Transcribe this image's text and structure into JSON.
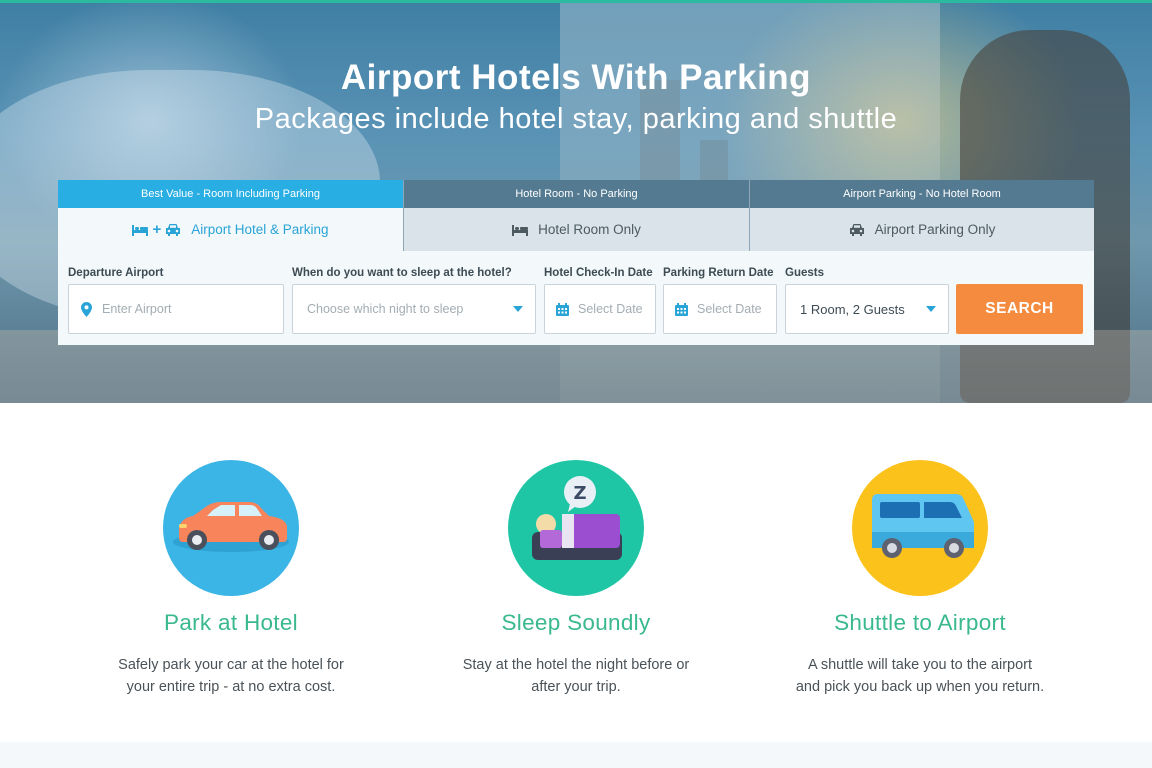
{
  "hero": {
    "title": "Airport Hotels With Parking",
    "subtitle": "Packages include hotel stay, parking and shuttle"
  },
  "tabs": [
    {
      "header": "Best Value - Room Including Parking",
      "label": "Airport Hotel & Parking",
      "icons": [
        "bed-icon",
        "plus-icon",
        "car-icon"
      ],
      "active": true
    },
    {
      "header": "Hotel Room - No Parking",
      "label": "Hotel Room Only",
      "icons": [
        "bed-icon"
      ],
      "active": false
    },
    {
      "header": "Airport Parking - No Hotel Room",
      "label": "Airport Parking Only",
      "icons": [
        "car-icon"
      ],
      "active": false
    }
  ],
  "form": {
    "departure": {
      "label": "Departure Airport",
      "placeholder": "Enter Airport",
      "icon": "map-pin-icon"
    },
    "sleep_night": {
      "label": "When do you want to sleep at the hotel?",
      "placeholder": "Choose which night to sleep"
    },
    "checkin": {
      "label": "Hotel Check-In Date",
      "placeholder": "Select Date",
      "icon": "calendar-icon"
    },
    "parking_return": {
      "label": "Parking Return Date",
      "placeholder": "Select Date",
      "icon": "calendar-icon"
    },
    "guests": {
      "label": "Guests",
      "value": "1 Room, 2 Guests"
    },
    "search_label": "SEARCH"
  },
  "features": [
    {
      "title": "Park at Hotel",
      "text_line1": "Safely park your car at the hotel for",
      "text_line2": "your entire trip - at no extra cost.",
      "icon": "car-icon"
    },
    {
      "title": "Sleep Soundly",
      "text_line1": "Stay at the hotel the night before or",
      "text_line2": "after your trip.",
      "icon": "sleep-icon"
    },
    {
      "title": "Shuttle to Airport",
      "text_line1": "A shuttle will take you to the airport",
      "text_line2": "and pick you back up when you return.",
      "icon": "shuttle-van-icon"
    }
  ],
  "colors": {
    "accent_blue": "#29aee3",
    "tab_dark": "#537a91",
    "search_orange": "#f58b3f",
    "feature_green": "#3ab88f"
  }
}
